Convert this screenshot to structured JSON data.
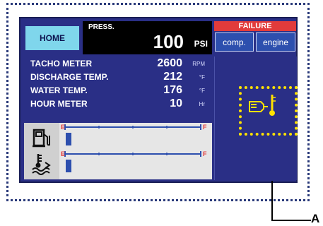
{
  "header": {
    "home_label": "HOME",
    "press_label": "PRESS.",
    "press_value": "100",
    "press_unit": "PSI"
  },
  "failure": {
    "title": "FAILURE",
    "buttons": [
      "comp.",
      "engine"
    ]
  },
  "gauges": [
    {
      "label": "TACHO METER",
      "value": "2600",
      "unit": "RPM"
    },
    {
      "label": "DISCHARGE TEMP.",
      "value": "212",
      "unit": "°F"
    },
    {
      "label": "WATER TEMP.",
      "value": "176",
      "unit": "°F"
    },
    {
      "label": "HOUR METER",
      "value": "10",
      "unit": "Hr"
    }
  ],
  "levels": [
    {
      "icon": "fuel-pump-icon",
      "empty_label": "E",
      "full_label": "F",
      "level": 0.04
    },
    {
      "icon": "coolant-level-icon",
      "empty_label": "E",
      "full_label": "F",
      "level": 0.04
    }
  ],
  "callout": {
    "label": "A"
  },
  "colors": {
    "screen_bg": "#2a2f86",
    "home_bg": "#7fd6ec",
    "failure_red": "#e23b3b",
    "warning_yellow": "#ffe100",
    "level_blue": "#2d4fae"
  }
}
